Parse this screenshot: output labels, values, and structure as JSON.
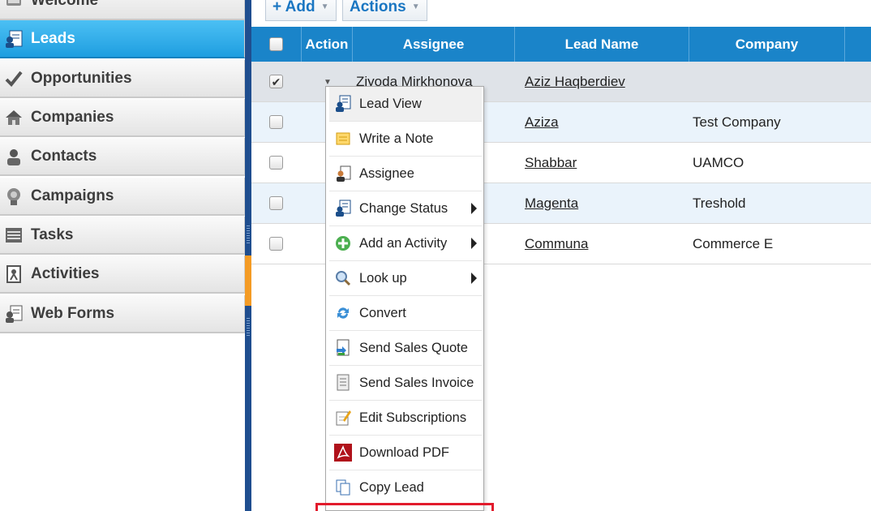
{
  "sidebar": {
    "items": [
      {
        "label": "Welcome",
        "icon": "welcome-icon",
        "active": false
      },
      {
        "label": "Leads",
        "icon": "leads-icon",
        "active": true
      },
      {
        "label": "Opportunities",
        "icon": "checkmark-icon",
        "active": false
      },
      {
        "label": "Companies",
        "icon": "house-icon",
        "active": false
      },
      {
        "label": "Contacts",
        "icon": "person-icon",
        "active": false
      },
      {
        "label": "Campaigns",
        "icon": "campaign-icon",
        "active": false
      },
      {
        "label": "Tasks",
        "icon": "tasks-icon",
        "active": false
      },
      {
        "label": "Activities",
        "icon": "activities-icon",
        "active": false
      },
      {
        "label": "Web Forms",
        "icon": "web-forms-icon",
        "active": false
      }
    ]
  },
  "toolbar": {
    "add_label": "+ Add",
    "actions_label": "Actions"
  },
  "grid": {
    "columns": [
      "",
      "Action",
      "Assignee",
      "Lead Name",
      "Company"
    ],
    "rows": [
      {
        "checked": true,
        "assignee": "Ziyoda Mirkhonova",
        "lead_name": "Aziz Haqberdiev",
        "company": ""
      },
      {
        "checked": false,
        "assignee": "",
        "lead_name": "Aziza",
        "company": "Test Company"
      },
      {
        "checked": false,
        "assignee": "",
        "lead_name": "Shabbar",
        "company": "UAMCO"
      },
      {
        "checked": false,
        "assignee": "",
        "lead_name": "Magenta",
        "company": "Treshold"
      },
      {
        "checked": false,
        "assignee": "",
        "lead_name": "Communa",
        "company": "Commerce E"
      }
    ]
  },
  "context_menu": {
    "items": [
      {
        "label": "Lead View",
        "icon": "lead-view-icon",
        "submenu": false
      },
      {
        "label": "Write a Note",
        "icon": "note-icon",
        "submenu": false
      },
      {
        "label": "Assignee",
        "icon": "assignee-icon",
        "submenu": false
      },
      {
        "label": "Change Status",
        "icon": "change-status-icon",
        "submenu": true
      },
      {
        "label": "Add an Activity",
        "icon": "add-activity-icon",
        "submenu": true
      },
      {
        "label": "Look up",
        "icon": "magnifier-icon",
        "submenu": true
      },
      {
        "label": "Convert",
        "icon": "convert-icon",
        "submenu": false
      },
      {
        "label": "Send Sales Quote",
        "icon": "sales-quote-icon",
        "submenu": false
      },
      {
        "label": "Send Sales Invoice",
        "icon": "sales-invoice-icon",
        "submenu": false
      },
      {
        "label": "Edit Subscriptions",
        "icon": "edit-subscriptions-icon",
        "submenu": false
      },
      {
        "label": "Download PDF",
        "icon": "pdf-icon",
        "submenu": false
      },
      {
        "label": "Copy Lead",
        "icon": "copy-icon",
        "submenu": false
      }
    ]
  },
  "colors": {
    "accent": "#1a84c9",
    "active_nav": "#29a8e8",
    "highlight": "#e21b2c"
  }
}
